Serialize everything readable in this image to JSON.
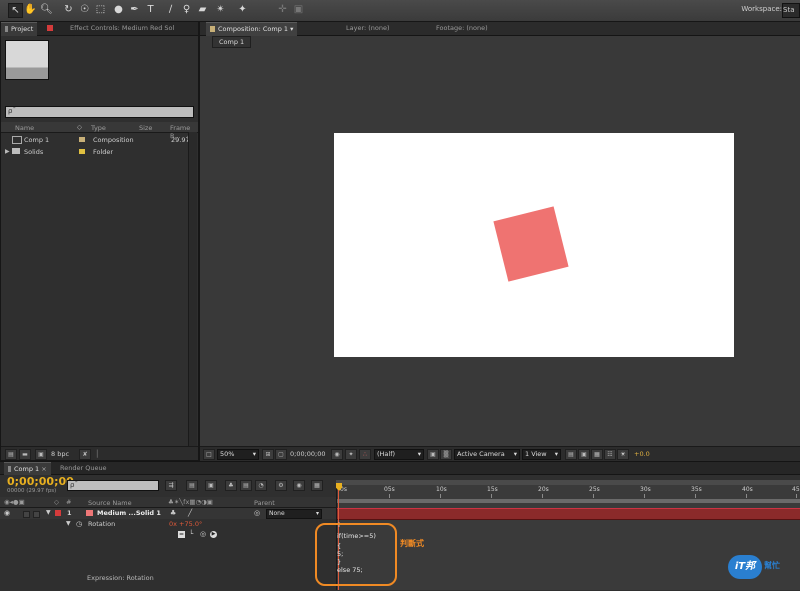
{
  "toolbar": {
    "workspace_label": "Workspace:",
    "workspace_value": "Sta",
    "tools": [
      "selection-arrow",
      "hand",
      "zoom",
      "rotation",
      "orbit-camera",
      "pan-behind",
      "rectangle",
      "pen",
      "type",
      "brush",
      "clone-stamp",
      "eraser",
      "roto-brush",
      "puppet-pin"
    ]
  },
  "left_panel": {
    "tabs": [
      "Project",
      "Effect Controls: Medium Red Sol"
    ],
    "search_placeholder": "ρˉ",
    "columns": [
      "Name",
      "Type",
      "Size",
      "Frame R..."
    ],
    "items": [
      {
        "name": "Comp 1",
        "type": "Composition",
        "frame_rate": "29.97",
        "color": "#c8b078"
      },
      {
        "name": "Solids",
        "type": "Folder",
        "frame_rate": "",
        "color": "#e0c040"
      }
    ],
    "bpc": "8 bpc"
  },
  "viewer": {
    "tabs": [
      "Composition: Comp 1",
      "Layer: (none)",
      "Footage: (none)"
    ],
    "sub_tab": "Comp 1",
    "zoom": "50%",
    "timecode": "0;00;00;00",
    "resolution": "(Half)",
    "camera": "Active Camera",
    "views": "1 View",
    "exposure": "+0.0",
    "layer_color": "#ef7371"
  },
  "timeline": {
    "tabs": [
      "Comp 1",
      "Render Queue"
    ],
    "timecode": "0;00;00;00",
    "fps": "00000 (29.97 fps)",
    "search_placeholder": "ρˉ",
    "source_name_header": "Source Name",
    "parent_header": "Parent",
    "layer_number": "1",
    "layer_name": "Medium ...Solid 1",
    "parent_value": "None",
    "property_name": "Rotation",
    "property_value": "0x +75.0°",
    "expression_label": "Expression: Rotation",
    "ruler_labels": [
      "0s",
      "05s",
      "10s",
      "15s",
      "20s",
      "25s",
      "30s",
      "35s",
      "40s",
      "45s"
    ],
    "code_lines": [
      "if(time>=5)",
      "{",
      "5;",
      "}",
      "else 75;"
    ],
    "annotation": "判斷式"
  },
  "watermark": {
    "text": "iT邦",
    "sub": "幫忙"
  }
}
